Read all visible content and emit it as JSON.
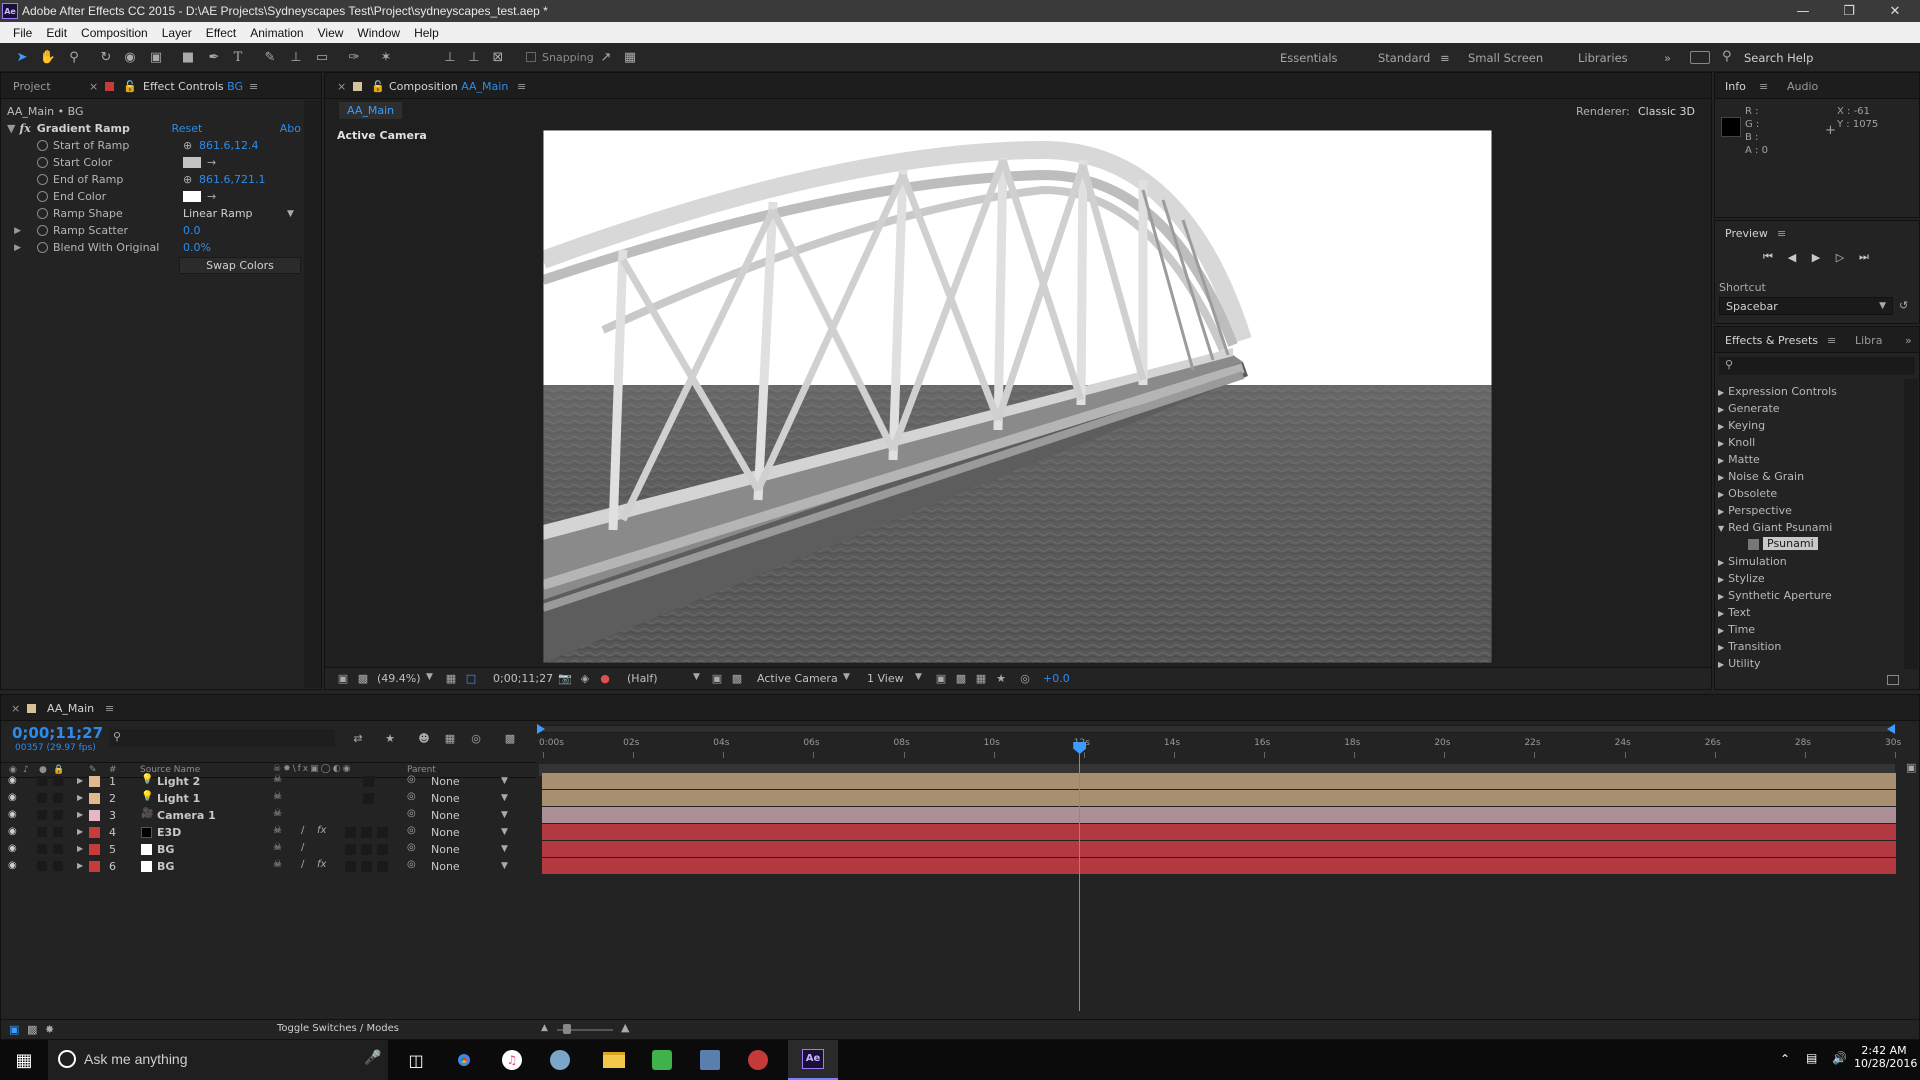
{
  "window": {
    "title": "Adobe After Effects CC 2015 - D:\\AE Projects\\Sydneyscapes Test\\Project\\sydneyscapes_test.aep *",
    "app_badge": "Ae"
  },
  "menu": [
    "File",
    "Edit",
    "Composition",
    "Layer",
    "Effect",
    "Animation",
    "View",
    "Window",
    "Help"
  ],
  "toolbar": {
    "snapping": "Snapping",
    "workspaces": [
      "Essentials",
      "Standard",
      "Small Screen",
      "Libraries"
    ],
    "active_workspace": "Standard",
    "search_placeholder": "Search Help"
  },
  "project_panel": {
    "tab": "Project"
  },
  "effect_controls": {
    "tab_prefix": "Effect Controls",
    "tab_layer": "BG",
    "breadcrumb": "AA_Main • BG",
    "effect_name": "Gradient Ramp",
    "reset": "Reset",
    "about": "Abo",
    "params": [
      {
        "name": "Start of Ramp",
        "value": "861.6,12.4"
      },
      {
        "name": "Start Color",
        "value": ""
      },
      {
        "name": "End of Ramp",
        "value": "861.6,721.1"
      },
      {
        "name": "End Color",
        "value": ""
      },
      {
        "name": "Ramp Shape",
        "value": "Linear Ramp"
      },
      {
        "name": "Ramp Scatter",
        "value": "0.0"
      },
      {
        "name": "Blend With Original",
        "value": "0.0%"
      }
    ],
    "swap_button": "Swap Colors",
    "start_color_hex": "#c4c4c4",
    "end_color_hex": "#ffffff"
  },
  "composition": {
    "tab_prefix": "Composition",
    "tab_name": "AA_Main",
    "sub_tab": "AA_Main",
    "renderer_label": "Renderer:",
    "renderer_value": "Classic 3D",
    "camera_label": "Active Camera",
    "footer": {
      "zoom": "(49.4%)",
      "timecode": "0;00;11;27",
      "resolution": "(Half)",
      "view": "Active Camera",
      "views": "1 View",
      "exposure": "+0.0"
    }
  },
  "info_panel": {
    "tab": "Info",
    "tab2": "Audio",
    "r": "R :",
    "g": "G :",
    "b": "B :",
    "a": "A : 0",
    "x": "X : -61",
    "y": "Y : 1075"
  },
  "preview_panel": {
    "tab": "Preview",
    "shortcut_label": "Shortcut",
    "shortcut_value": "Spacebar"
  },
  "effects_presets": {
    "tab": "Effects & Presets",
    "tab2": "Libra",
    "items": [
      {
        "label": "Expression Controls",
        "expanded": false
      },
      {
        "label": "Generate",
        "expanded": false
      },
      {
        "label": "Keying",
        "expanded": false
      },
      {
        "label": "Knoll",
        "expanded": false
      },
      {
        "label": "Matte",
        "expanded": false
      },
      {
        "label": "Noise & Grain",
        "expanded": false
      },
      {
        "label": "Obsolete",
        "expanded": false
      },
      {
        "label": "Perspective",
        "expanded": false
      },
      {
        "label": "Red Giant Psunami",
        "expanded": true
      },
      {
        "label": "Psunami",
        "child": true
      },
      {
        "label": "Simulation",
        "expanded": false
      },
      {
        "label": "Stylize",
        "expanded": false
      },
      {
        "label": "Synthetic Aperture",
        "expanded": false
      },
      {
        "label": "Text",
        "expanded": false
      },
      {
        "label": "Time",
        "expanded": false
      },
      {
        "label": "Transition",
        "expanded": false
      },
      {
        "label": "Utility",
        "expanded": false
      }
    ]
  },
  "timeline": {
    "tab": "AA_Main",
    "timecode": "0;00;11;27",
    "frame_info": "00357 (29.97 fps)",
    "col_hash": "#",
    "col_source": "Source Name",
    "col_parent": "Parent",
    "ruler": [
      "0:00s",
      "02s",
      "04s",
      "06s",
      "08s",
      "10s",
      "12s",
      "14s",
      "16s",
      "18s",
      "20s",
      "22s",
      "24s",
      "26s",
      "28s",
      "30s"
    ],
    "playhead_fraction": 0.3966,
    "layers": [
      {
        "num": "1",
        "name": "Light 2",
        "label_color": "#e3b98c",
        "track_color": "#a98f72",
        "parent": "None",
        "type": "light"
      },
      {
        "num": "2",
        "name": "Light 1",
        "label_color": "#e3b98c",
        "track_color": "#a98f72",
        "parent": "None",
        "type": "light"
      },
      {
        "num": "3",
        "name": "Camera 1",
        "label_color": "#e6b8c6",
        "track_color": "#ad8f98",
        "parent": "None",
        "type": "camera"
      },
      {
        "num": "4",
        "name": "E3D",
        "label_color": "#c83b3b",
        "track_color": "#b1393f",
        "parent": "None",
        "type": "solid-black"
      },
      {
        "num": "5",
        "name": "BG",
        "label_color": "#c83b3b",
        "track_color": "#b1393f",
        "parent": "None",
        "type": "solid-white"
      },
      {
        "num": "6",
        "name": "BG",
        "label_color": "#c83b3b",
        "track_color": "#b1393f",
        "parent": "None",
        "type": "solid-white"
      }
    ],
    "toggle_label": "Toggle Switches / Modes"
  },
  "taskbar": {
    "search_placeholder": "Ask me anything",
    "time": "2:42 AM",
    "date": "10/28/2016"
  }
}
